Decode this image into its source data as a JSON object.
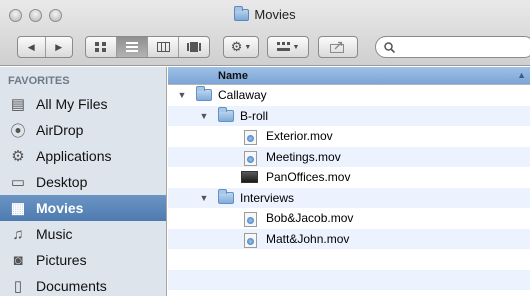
{
  "window": {
    "title": "Movies",
    "title_icon": "folder-icon"
  },
  "toolbar": {
    "back_icon": "◀",
    "forward_icon": "▶",
    "view_modes": [
      "icon-view",
      "list-view",
      "column-view",
      "coverflow-view"
    ],
    "active_view": "list-view",
    "action_icon": "gear-icon",
    "arrange_icon": "arrange-icon",
    "share_icon": "share-icon",
    "search_placeholder": "",
    "search_value": ""
  },
  "sidebar": {
    "heading": "FAVORITES",
    "items": [
      {
        "label": "All My Files",
        "icon": "all-files-icon",
        "glyph": "▤"
      },
      {
        "label": "AirDrop",
        "icon": "airdrop-icon",
        "glyph": "⦿"
      },
      {
        "label": "Applications",
        "icon": "applications-icon",
        "glyph": "⚙"
      },
      {
        "label": "Desktop",
        "icon": "desktop-icon",
        "glyph": "▭"
      },
      {
        "label": "Movies",
        "icon": "movies-icon",
        "glyph": "▦",
        "selected": true
      },
      {
        "label": "Music",
        "icon": "music-icon",
        "glyph": "♫"
      },
      {
        "label": "Pictures",
        "icon": "pictures-icon",
        "glyph": "◙"
      },
      {
        "label": "Documents",
        "icon": "documents-icon",
        "glyph": "▯"
      }
    ]
  },
  "list": {
    "column_header": "Name",
    "rows": [
      {
        "label": "Callaway",
        "type": "folder",
        "level": 0,
        "expanded": true
      },
      {
        "label": "B-roll",
        "type": "folder",
        "level": 1,
        "expanded": true
      },
      {
        "label": "Exterior.mov",
        "type": "movie",
        "level": 2
      },
      {
        "label": "Meetings.mov",
        "type": "movie",
        "level": 2
      },
      {
        "label": "PanOffices.mov",
        "type": "movie-thumb",
        "level": 2
      },
      {
        "label": "Interviews",
        "type": "folder",
        "level": 1,
        "expanded": true
      },
      {
        "label": "Bob&Jacob.mov",
        "type": "movie",
        "level": 2
      },
      {
        "label": "Matt&John.mov",
        "type": "movie",
        "level": 2
      }
    ]
  },
  "colors": {
    "sidebar_bg": "#dde4ec",
    "selection": "#5884b8",
    "header_blue": "#8db3df",
    "row_alt": "#edf3fe"
  }
}
